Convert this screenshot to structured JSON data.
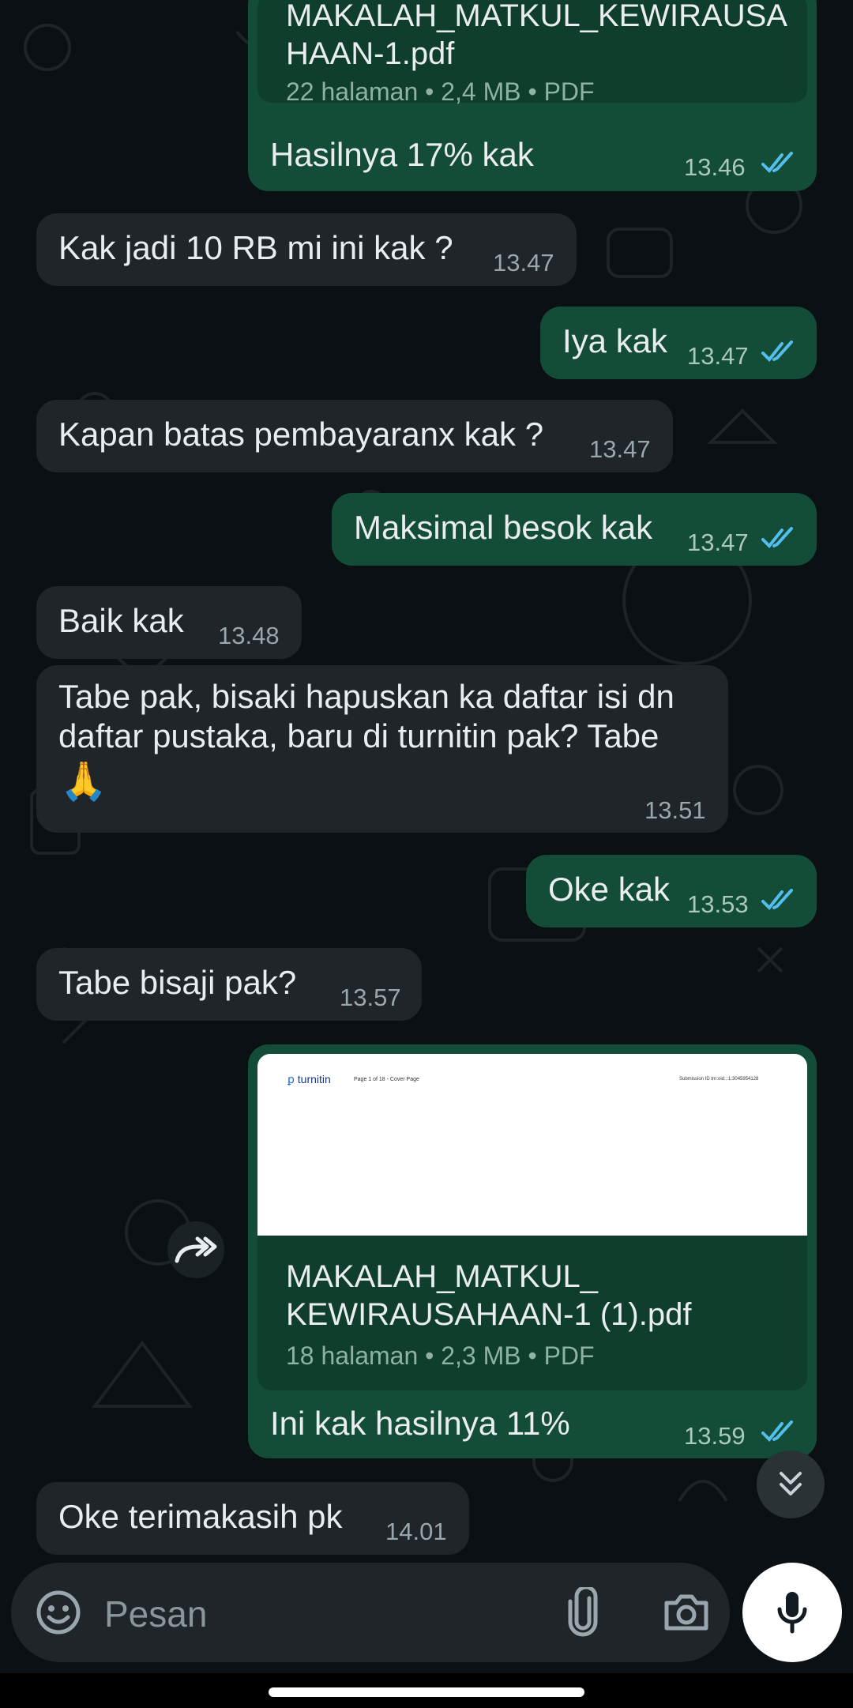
{
  "colors": {
    "background": "#0b1014",
    "incoming_bubble": "#1f2529",
    "outgoing_bubble": "#134d37",
    "read_ticks": "#53bdeb"
  },
  "messages": {
    "m1": {
      "doc_name_line1": "MAKALAH_MATKUL_KEWIRAUSA",
      "doc_name_line2": "HAAN-1.pdf",
      "doc_meta": "22 halaman • 2,4 MB • PDF",
      "text": "Hasilnya 17% kak",
      "time": "13.46"
    },
    "m2": {
      "text": "Kak jadi 10 RB mi ini kak ?",
      "time": "13.47"
    },
    "m3": {
      "text": "Iya kak",
      "time": "13.47"
    },
    "m4": {
      "text": "Kapan batas pembayaranx kak ?",
      "time": "13.47"
    },
    "m5": {
      "text": "Maksimal besok kak",
      "time": "13.47"
    },
    "m6": {
      "text": "Baik kak",
      "time": "13.48"
    },
    "m7": {
      "line1": "Tabe pak, bisaki hapuskan ka daftar isi dn",
      "line2": "daftar pustaka, baru di turnitin pak? Tabe",
      "emoji": "🙏",
      "time": "13.51"
    },
    "m8": {
      "text": "Oke kak",
      "time": "13.53"
    },
    "m9": {
      "text": "Tabe bisaji pak?",
      "time": "13.57"
    },
    "m10": {
      "preview_brand": "turnitin",
      "preview_page": "Page 1 of 18 - Cover Page",
      "preview_submission": "Submission ID trn:oid:::1:3045954128",
      "doc_name_line1": "MAKALAH_MATKUL_",
      "doc_name_line2": "KEWIRAUSAHAAN-1 (1).pdf",
      "doc_meta": "18 halaman • 2,3 MB • PDF",
      "text": "Ini kak hasilnya 11%",
      "time": "13.59"
    },
    "m11": {
      "text": "Oke terimakasih pk",
      "time": "14.01"
    }
  },
  "composer": {
    "placeholder": "Pesan",
    "icons": [
      "sticker-icon",
      "attach-icon",
      "camera-icon",
      "mic-icon"
    ]
  },
  "floating": {
    "forward_icon": "forward-icon",
    "scroll_icon": "scroll-down-icon"
  }
}
